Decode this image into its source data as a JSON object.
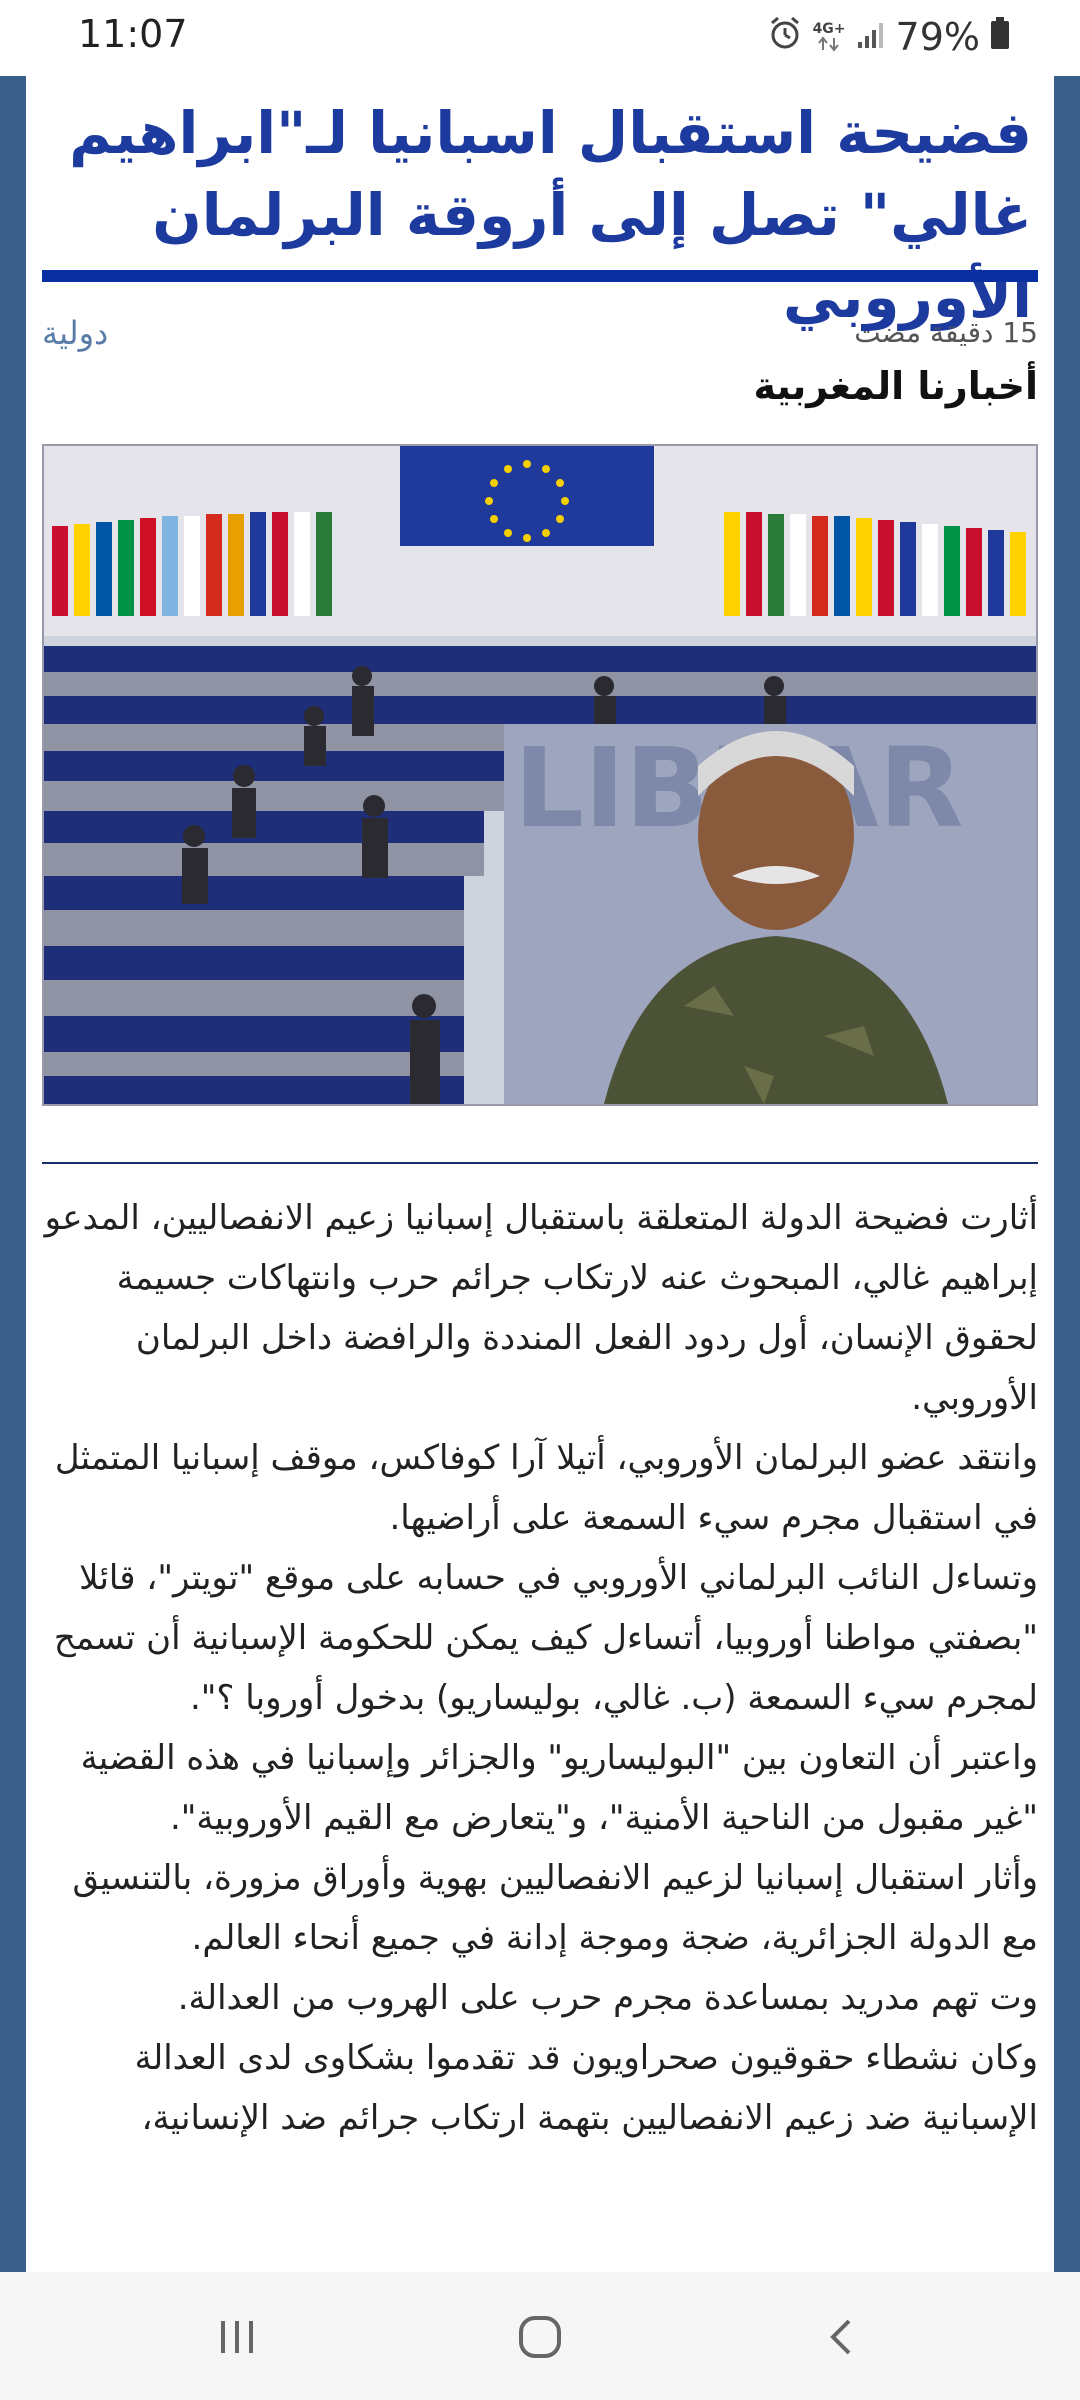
{
  "status_bar": {
    "time": "11:07",
    "network": "4G+",
    "battery": "79%",
    "icons": [
      "alarm-icon",
      "network-4g-icon",
      "signal-icon",
      "battery-icon"
    ]
  },
  "article": {
    "title": "فضيحة استقبال اسبانيا لـ\"ابراهيم غالي\" تصل إلى أروقة البرلمان الأوروبي",
    "category": "دولية",
    "time_ago": "15 دقيقة مضت",
    "source": "أخبارنا المغربية",
    "image": {
      "flag_text": "LIBRAR"
    },
    "paragraphs": [
      "أثارت فضيحة الدولة المتعلقة باستقبال إسبانيا زعيم الانفصاليين، المدعو إبراهيم غالي، المبحوث عنه لارتكاب جرائم حرب وانتهاكات جسيمة لحقوق الإنسان، أول ردود الفعل المنددة والرافضة داخل البرلمان الأوروبي.",
      "وانتقد عضو البرلمان الأوروبي، أتيلا آرا كوفاكس، موقف إسبانيا المتمثل في استقبال مجرم سيء السمعة على أراضيها.",
      "وتساءل النائب البرلماني الأوروبي في حسابه على موقع \"تويتر\"، قائلا \"بصفتي مواطنا أوروبيا، أتساءل كيف يمكن للحكومة الإسبانية أن تسمح لمجرم سيء السمعة (ب. غالي، بوليساريو) بدخول أوروبا ؟\".",
      "واعتبر أن التعاون بين \"البوليساريو\" والجزائر وإسبانيا في هذه القضية \"غير مقبول من الناحية الأمنية\"، و\"يتعارض مع القيم الأوروبية\".",
      "وأثار استقبال إسبانيا لزعيم الانفصاليين بهوية وأوراق مزورة، بالتنسيق مع الدولة الجزائرية، ضجة وموجة إدانة في جميع أنحاء العالم.",
      "وت تهم مدريد بمساعدة مجرم حرب على الهروب من العدالة.",
      "وكان نشطاء حقوقيون صحراويون قد تقدموا بشكاوى لدى العدالة الإسبانية ضد زعيم الانفصاليين بتهمة ارتكاب جرائم ضد الإنسانية،"
    ]
  },
  "colors": {
    "title": "#1d3a9e",
    "title_rule": "#0a2fa0",
    "side_frame": "#3a5f8a",
    "category": "#5a7ca8"
  },
  "nav": {
    "icons": [
      "recent-apps-icon",
      "home-icon",
      "back-icon"
    ]
  }
}
